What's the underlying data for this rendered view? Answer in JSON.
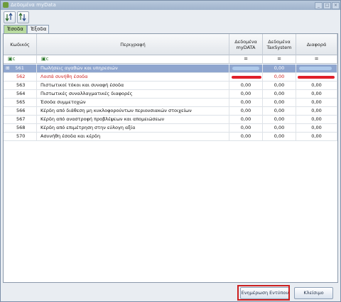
{
  "window": {
    "title": "Δεδομένα myData",
    "controls": [
      "_",
      "□",
      "×"
    ]
  },
  "toolbar": {
    "buttons": [
      {
        "icon": "sort-down-icon"
      },
      {
        "icon": "sort-up-icon"
      }
    ]
  },
  "tabs": [
    {
      "label": "Έσοδα",
      "active": true
    },
    {
      "label": "Έξοδα",
      "active": false
    }
  ],
  "table": {
    "columns": [
      {
        "label": "Κωδικός"
      },
      {
        "label": "Περιγραφή"
      },
      {
        "label": "Δεδομένα myDATA"
      },
      {
        "label": "Δεδομένα TaxSystem"
      },
      {
        "label": "Διαφορά"
      }
    ],
    "filters": {
      "code": "▣c",
      "desc": "▣c",
      "mydata": "=",
      "taxsystem": "=",
      "diff": "="
    },
    "rows": [
      {
        "code": "561",
        "desc": "Πωλήσεις αγαθών και υπηρεσιών",
        "mydata": "",
        "taxsystem": "0,00",
        "diff": "",
        "selected": true,
        "expander": "⊞"
      },
      {
        "code": "562",
        "desc": "Λοιπά συνήθη έσοδα",
        "mydata": "",
        "taxsystem": "0,00",
        "diff": "",
        "error": true
      },
      {
        "code": "563",
        "desc": "Πιστωτικοί τόκοι και συναφή έσοδα",
        "mydata": "0,00",
        "taxsystem": "0,00",
        "diff": "0,00"
      },
      {
        "code": "564",
        "desc": "Πιστωτικές συναλλαγματικές διαφορές",
        "mydata": "0,00",
        "taxsystem": "0,00",
        "diff": "0,00"
      },
      {
        "code": "565",
        "desc": "Έσοδα συμμετοχών",
        "mydata": "0,00",
        "taxsystem": "0,00",
        "diff": "0,00"
      },
      {
        "code": "566",
        "desc": "Κέρδη από διάθεση μη κυκλοφορούντων περιουσιακών στοιχείων",
        "mydata": "0,00",
        "taxsystem": "0,00",
        "diff": "0,00"
      },
      {
        "code": "567",
        "desc": "Κέρδη από αναστροφή  προβλέψεων και απομειώσεων",
        "mydata": "0,00",
        "taxsystem": "0,00",
        "diff": "0,00"
      },
      {
        "code": "568",
        "desc": "Κέρδη από επιμέτρηση στην εύλογη αξία",
        "mydata": "0,00",
        "taxsystem": "0,00",
        "diff": "0,00"
      },
      {
        "code": "570",
        "desc": "Ασυνήθη έσοδα και κέρδη",
        "mydata": "0,00",
        "taxsystem": "0,00",
        "diff": "0,00"
      }
    ]
  },
  "footer": {
    "update_label": "Ενημέρωση Εντύπου",
    "close_label": "Κλείσιμο"
  },
  "colors": {
    "selected_row": "#8fa6cf",
    "error_text": "#cc1f1f",
    "highlight_border": "#cc1f1f",
    "active_tab": "#b9dba0"
  }
}
